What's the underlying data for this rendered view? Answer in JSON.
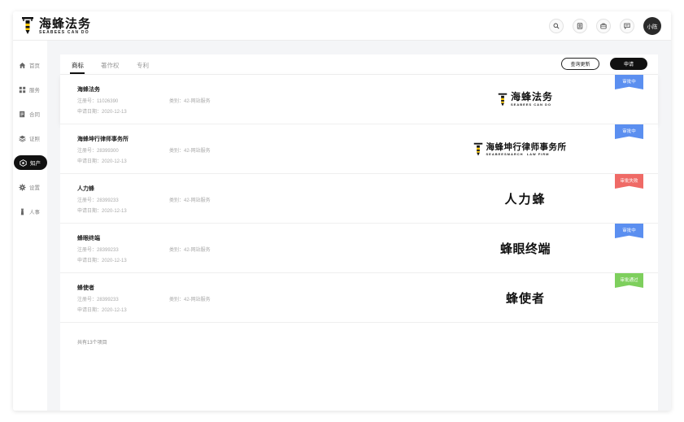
{
  "header": {
    "logo_cn": "海蜂法务",
    "logo_en": "SEABEES CAN DO",
    "avatar_label": "小陈",
    "icons": [
      "search-icon",
      "contacts-icon",
      "briefcase-icon",
      "message-icon"
    ]
  },
  "sidebar": {
    "items": [
      {
        "label": "首页",
        "icon": "home-icon"
      },
      {
        "label": "服务",
        "icon": "grid-icon"
      },
      {
        "label": "合同",
        "icon": "contract-icon"
      },
      {
        "label": "证照",
        "icon": "layers-icon"
      },
      {
        "label": "知产",
        "icon": "ip-icon",
        "active": true
      },
      {
        "label": "设置",
        "icon": "gear-icon"
      },
      {
        "label": "人事",
        "icon": "person-icon"
      }
    ]
  },
  "tabs": [
    {
      "label": "商标",
      "active": true
    },
    {
      "label": "著作权"
    },
    {
      "label": "专利"
    }
  ],
  "buttons": {
    "query_update": "查询更新",
    "apply": "申请"
  },
  "trademarks": [
    {
      "name": "海蜂法务",
      "reg_no": "注册号：11026390",
      "category": "类别：42-网站服务",
      "apply_date": "申请日期：2020-12-13",
      "mark_text": "海蜂法务",
      "mark_sub": "SEABEES CAN DO",
      "status": "审批中",
      "status_color": "#5b8ff0"
    },
    {
      "name": "海蜂坤行律师事务所",
      "reg_no": "注册号：28399300",
      "category": "类别：42-网站服务",
      "apply_date": "申请日期：2020-12-13",
      "mark_text": "海蜂坤行律师事务所",
      "mark_sub": "SEABEESMARCH  LAW FIRM",
      "status": "审批中",
      "status_color": "#5b8ff0"
    },
    {
      "name": "人力蜂",
      "reg_no": "注册号：28399233",
      "category": "类别：42-网站服务",
      "apply_date": "申请日期：2020-12-13",
      "mark_text": "人力蜂",
      "status": "审批失败",
      "status_color": "#ef6a66"
    },
    {
      "name": "蜂眼终端",
      "reg_no": "注册号：28399233",
      "category": "类别：42-网站服务",
      "apply_date": "申请日期：2020-12-13",
      "mark_text": "蜂眼终端",
      "status": "审批中",
      "status_color": "#5b8ff0"
    },
    {
      "name": "蜂使者",
      "reg_no": "注册号：28399233",
      "category": "类别：42-网站服务",
      "apply_date": "申请日期：2020-12-13",
      "mark_text": "蜂使者",
      "status": "审批通过",
      "status_color": "#7ecf5d"
    }
  ],
  "footer": {
    "count_text": "共有13个项目"
  }
}
